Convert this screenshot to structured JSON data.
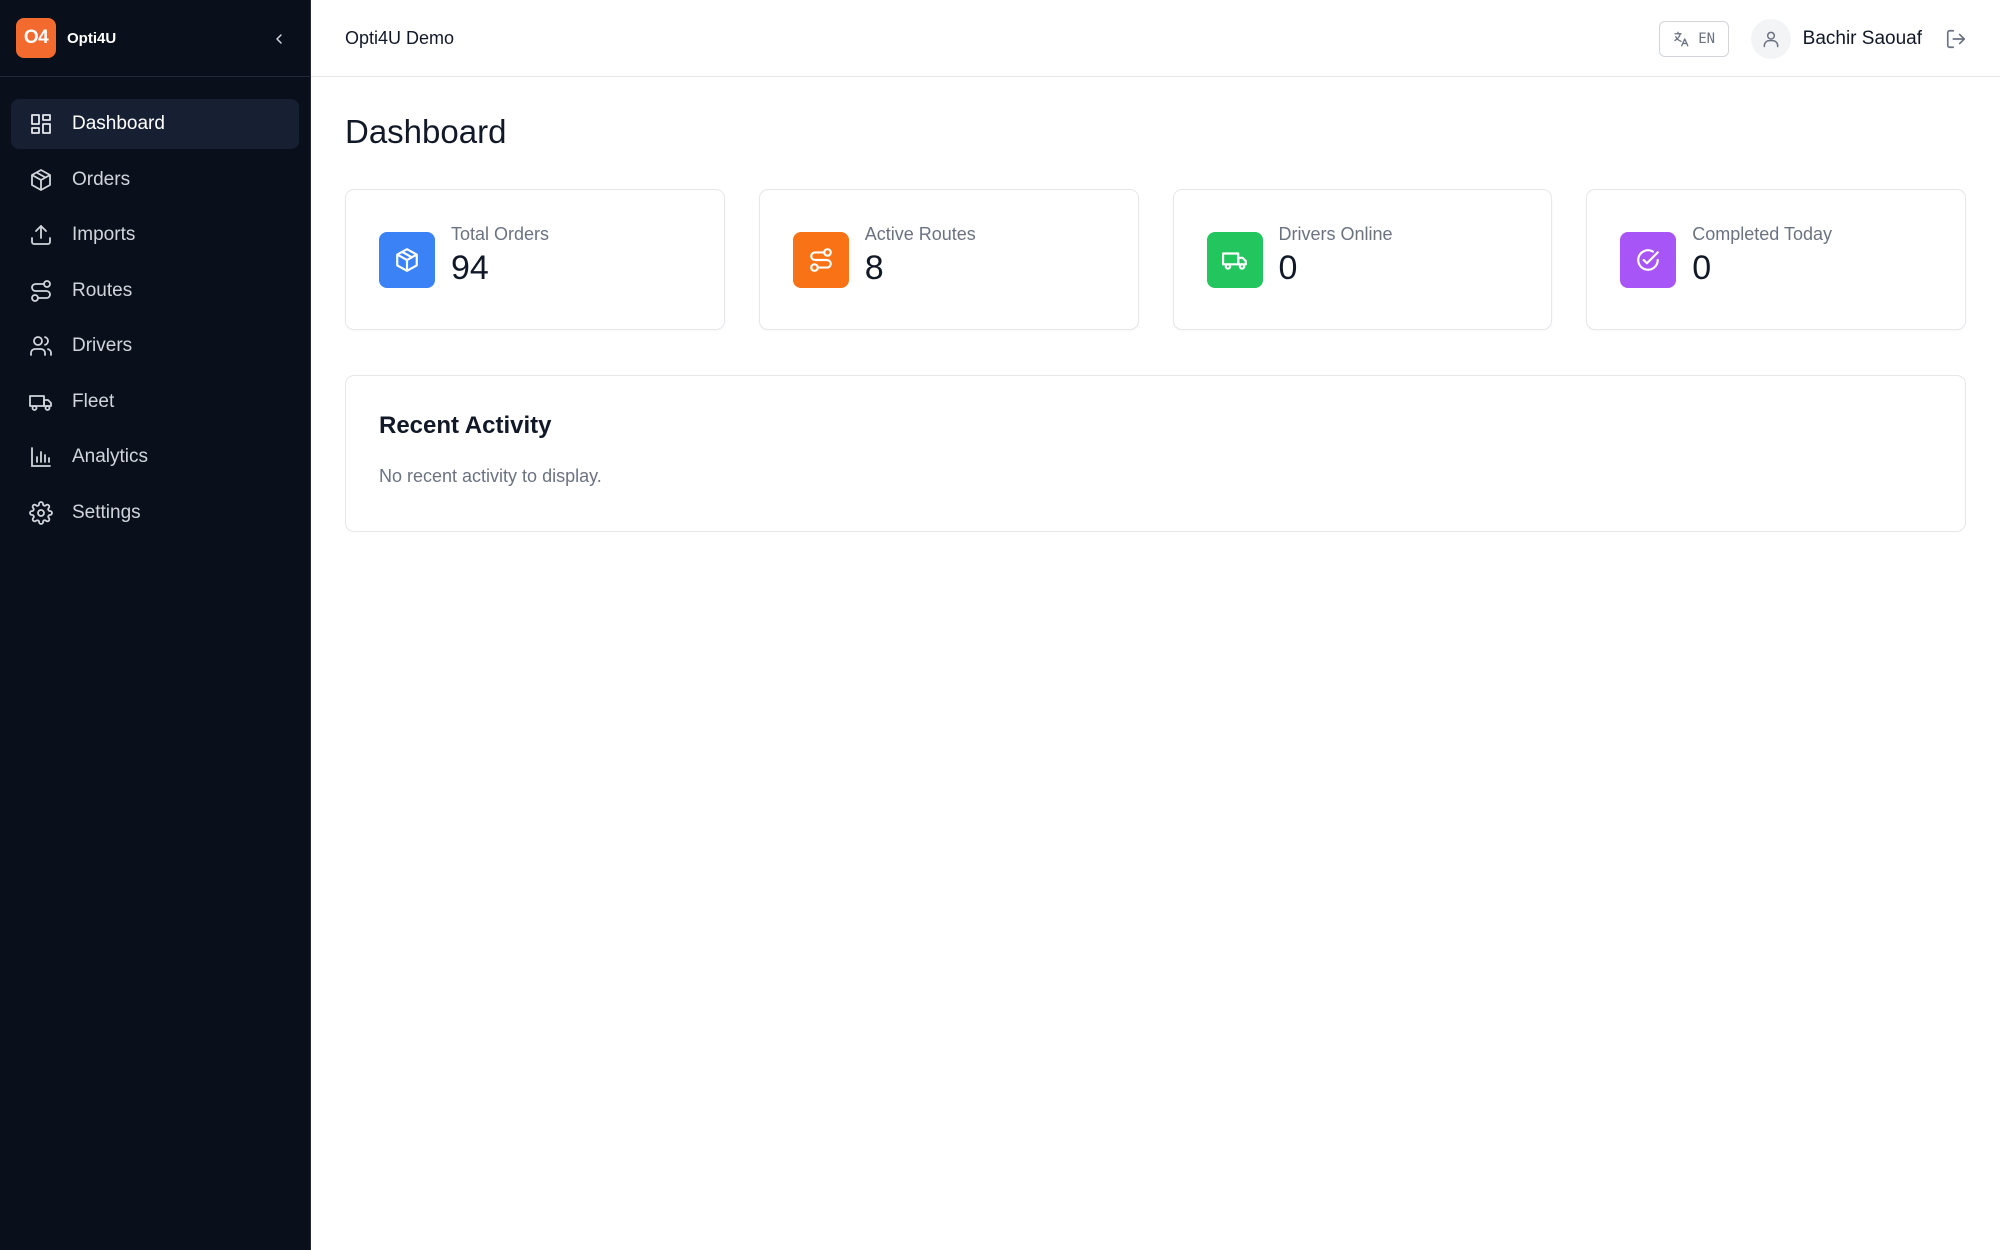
{
  "brand": {
    "logo_text": "O4",
    "name": "Opti4U"
  },
  "sidebar": {
    "items": [
      {
        "label": "Dashboard",
        "icon": "dashboard-icon",
        "active": true
      },
      {
        "label": "Orders",
        "icon": "package-icon",
        "active": false
      },
      {
        "label": "Imports",
        "icon": "upload-icon",
        "active": false
      },
      {
        "label": "Routes",
        "icon": "route-icon",
        "active": false
      },
      {
        "label": "Drivers",
        "icon": "users-icon",
        "active": false
      },
      {
        "label": "Fleet",
        "icon": "truck-icon",
        "active": false
      },
      {
        "label": "Analytics",
        "icon": "bar-chart-icon",
        "active": false
      },
      {
        "label": "Settings",
        "icon": "gear-icon",
        "active": false
      }
    ]
  },
  "header": {
    "org_name": "Opti4U Demo",
    "language": "EN",
    "user_name": "Bachir Saouaf"
  },
  "main": {
    "title": "Dashboard",
    "stats": [
      {
        "label": "Total Orders",
        "value": "94",
        "color": "#3b82f6",
        "icon": "package-icon"
      },
      {
        "label": "Active Routes",
        "value": "8",
        "color": "#f97316",
        "icon": "route-icon"
      },
      {
        "label": "Drivers Online",
        "value": "0",
        "color": "#22c55e",
        "icon": "truck-icon"
      },
      {
        "label": "Completed Today",
        "value": "0",
        "color": "#a855f7",
        "icon": "check-circle-icon"
      }
    ],
    "activity": {
      "title": "Recent Activity",
      "empty_text": "No recent activity to display."
    }
  }
}
